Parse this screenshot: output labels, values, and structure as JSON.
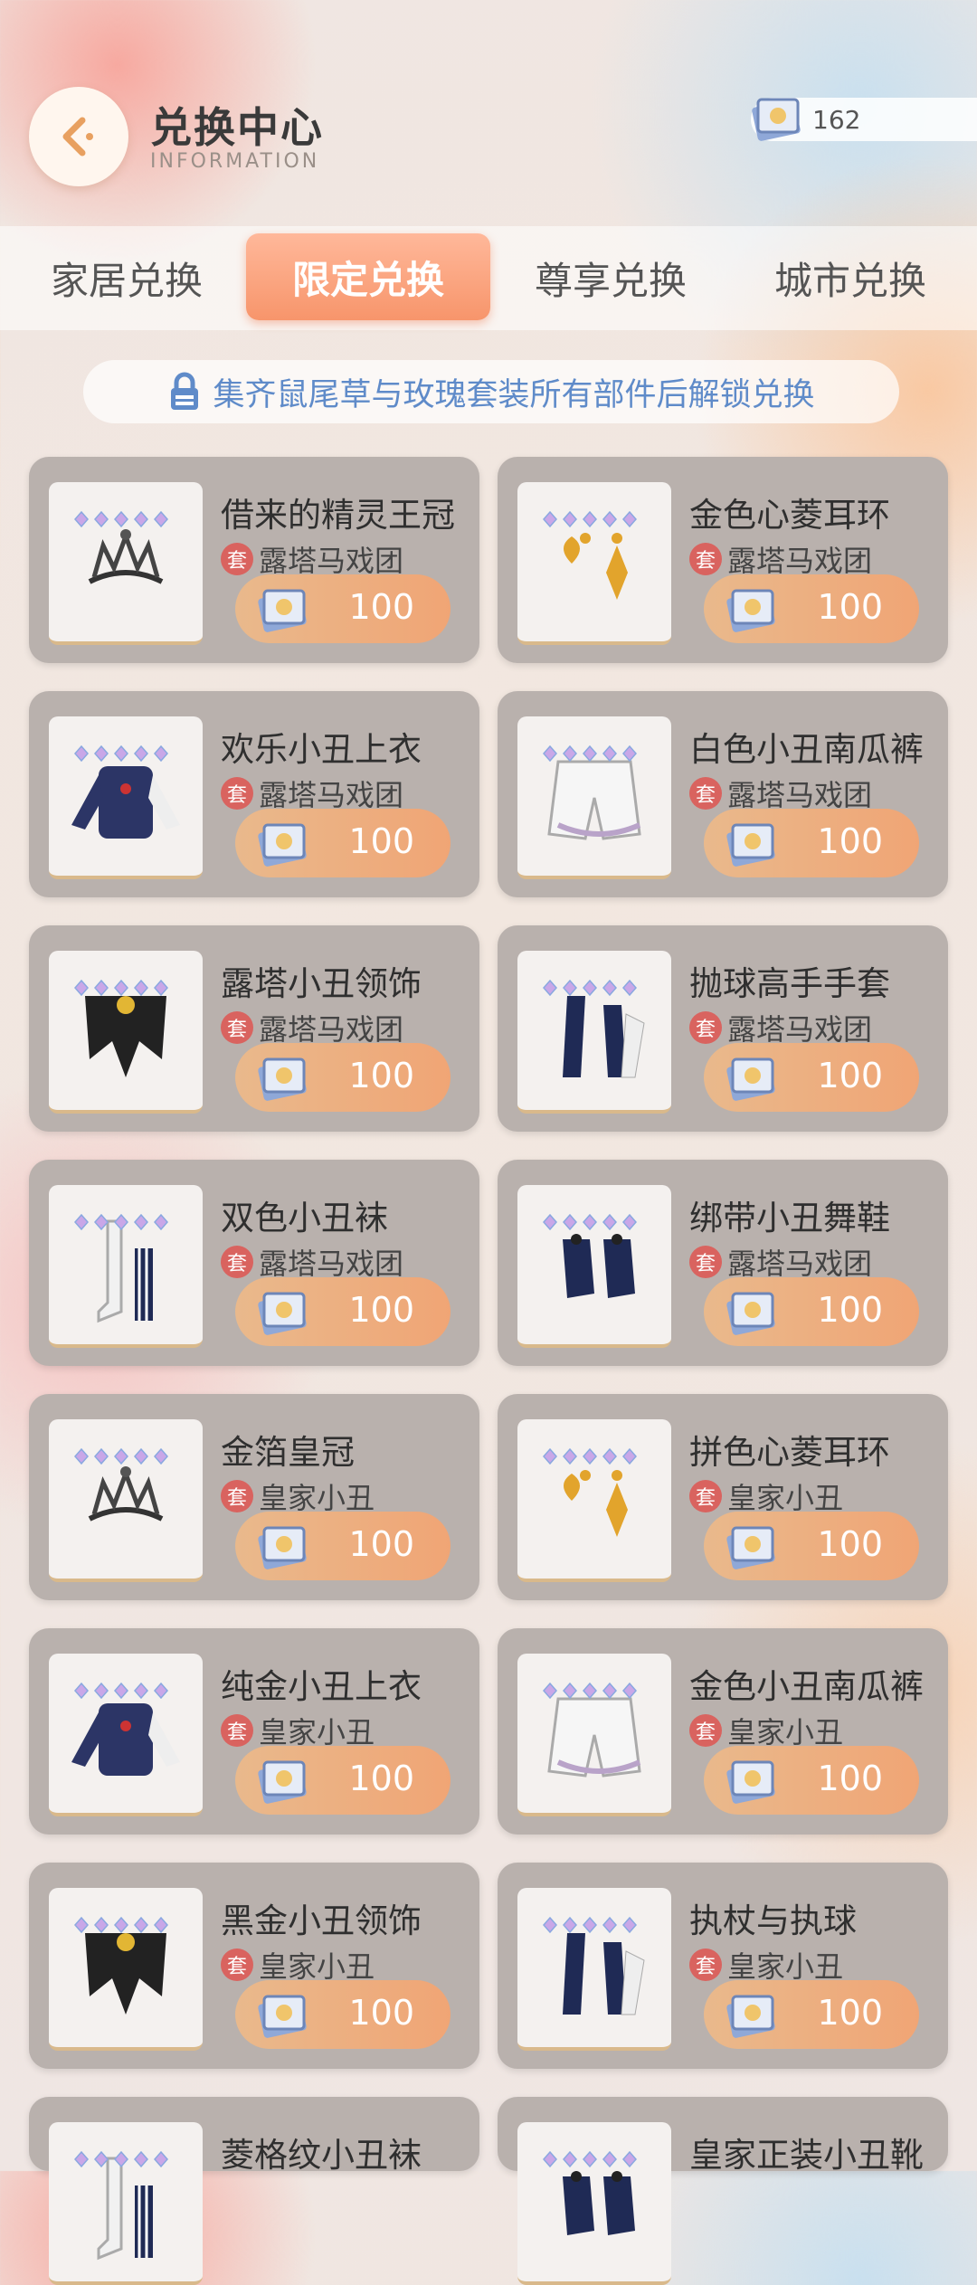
{
  "header": {
    "title": "兑换中心",
    "subtitle": "INFORMATION",
    "back_icon": "back-arrow-icon",
    "currency": {
      "icon": "ticket-icon",
      "value": "162"
    }
  },
  "tabs": [
    {
      "label": "家居兑换",
      "active": false
    },
    {
      "label": "限定兑换",
      "active": true
    },
    {
      "label": "尊享兑换",
      "active": false
    },
    {
      "label": "城市兑换",
      "active": false
    }
  ],
  "banner": {
    "icon": "lock-icon",
    "text": "集齐鼠尾草与玫瑰套装所有部件后解锁兑换"
  },
  "set_badge_label": "套",
  "items": [
    {
      "name": "借来的精灵王冠",
      "set": "露塔马戏团",
      "price": "100",
      "icon": "crown-icon"
    },
    {
      "name": "金色心菱耳环",
      "set": "露塔马戏团",
      "price": "100",
      "icon": "earring-icon"
    },
    {
      "name": "欢乐小丑上衣",
      "set": "露塔马戏团",
      "price": "100",
      "icon": "top-icon"
    },
    {
      "name": "白色小丑南瓜裤",
      "set": "露塔马戏团",
      "price": "100",
      "icon": "pants-icon"
    },
    {
      "name": "露塔小丑领饰",
      "set": "露塔马戏团",
      "price": "100",
      "icon": "collar-icon"
    },
    {
      "name": "抛球高手手套",
      "set": "露塔马戏团",
      "price": "100",
      "icon": "gloves-icon"
    },
    {
      "name": "双色小丑袜",
      "set": "露塔马戏团",
      "price": "100",
      "icon": "socks-icon"
    },
    {
      "name": "绑带小丑舞鞋",
      "set": "露塔马戏团",
      "price": "100",
      "icon": "shoes-icon"
    },
    {
      "name": "金箔皇冠",
      "set": "皇家小丑",
      "price": "100",
      "icon": "crown-icon"
    },
    {
      "name": "拼色心菱耳环",
      "set": "皇家小丑",
      "price": "100",
      "icon": "earring-icon"
    },
    {
      "name": "纯金小丑上衣",
      "set": "皇家小丑",
      "price": "100",
      "icon": "top-icon"
    },
    {
      "name": "金色小丑南瓜裤",
      "set": "皇家小丑",
      "price": "100",
      "icon": "pants-icon"
    },
    {
      "name": "黑金小丑领饰",
      "set": "皇家小丑",
      "price": "100",
      "icon": "collar-icon"
    },
    {
      "name": "执杖与执球",
      "set": "皇家小丑",
      "price": "100",
      "icon": "gloves-icon"
    },
    {
      "name": "菱格纹小丑袜",
      "set": "",
      "price": "",
      "icon": "socks-icon"
    },
    {
      "name": "皇家正装小丑靴",
      "set": "",
      "price": "",
      "icon": "shoes-icon"
    }
  ]
}
